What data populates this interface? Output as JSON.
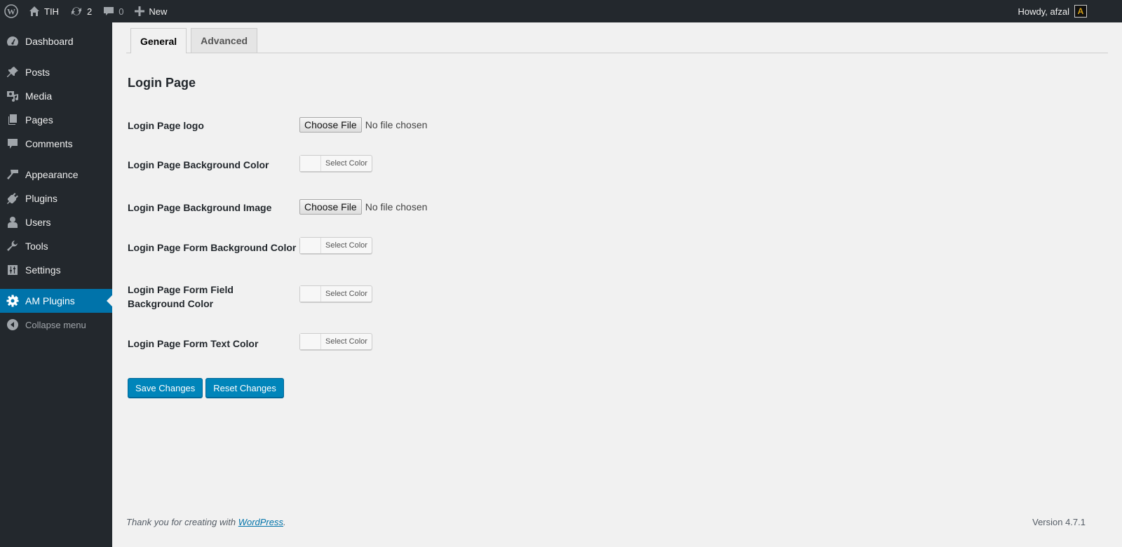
{
  "adminbar": {
    "site_name": "TIH",
    "updates_count": "2",
    "comments_count": "0",
    "new_label": "New",
    "greeting": "Howdy, afzal",
    "avatar_letter": "A"
  },
  "sidebar": {
    "items": [
      {
        "label": "Dashboard",
        "icon": "dashboard-icon"
      },
      {
        "label": "Posts",
        "icon": "pin-icon"
      },
      {
        "label": "Media",
        "icon": "media-icon"
      },
      {
        "label": "Pages",
        "icon": "pages-icon"
      },
      {
        "label": "Comments",
        "icon": "comment-icon"
      },
      {
        "label": "Appearance",
        "icon": "brush-icon"
      },
      {
        "label": "Plugins",
        "icon": "plug-icon"
      },
      {
        "label": "Users",
        "icon": "user-icon"
      },
      {
        "label": "Tools",
        "icon": "wrench-icon"
      },
      {
        "label": "Settings",
        "icon": "settings-icon"
      },
      {
        "label": "AM Plugins",
        "icon": "gear-icon"
      },
      {
        "label": "Collapse menu",
        "icon": "collapse-icon"
      }
    ],
    "active": "AM Plugins"
  },
  "main": {
    "tabs": [
      {
        "label": "General",
        "active": true
      },
      {
        "label": "Advanced",
        "active": false
      }
    ],
    "section_title": "Login Page",
    "fields": [
      {
        "label": "Login Page logo",
        "type": "file",
        "button": "Choose File",
        "status": "No file chosen"
      },
      {
        "label": "Login Page Background Color",
        "type": "color",
        "button": "Select Color"
      },
      {
        "label": "Login Page Background Image",
        "type": "file",
        "button": "Choose File",
        "status": "No file chosen"
      },
      {
        "label": "Login Page Form Background Color",
        "type": "color",
        "button": "Select Color"
      },
      {
        "label": "Login Page Form Field Background Color",
        "type": "color",
        "button": "Select Color"
      },
      {
        "label": "Login Page Form Text Color",
        "type": "color",
        "button": "Select Color"
      }
    ],
    "save_label": "Save Changes",
    "reset_label": "Reset Changes"
  },
  "footer": {
    "thanks_prefix": "Thank you for creating with ",
    "thanks_link": "WordPress",
    "thanks_suffix": ".",
    "version": "Version 4.7.1"
  },
  "colors": {
    "accent": "#0073aa",
    "button": "#0085ba",
    "adminbar_bg": "#23282d",
    "page_bg": "#f1f1f1"
  }
}
